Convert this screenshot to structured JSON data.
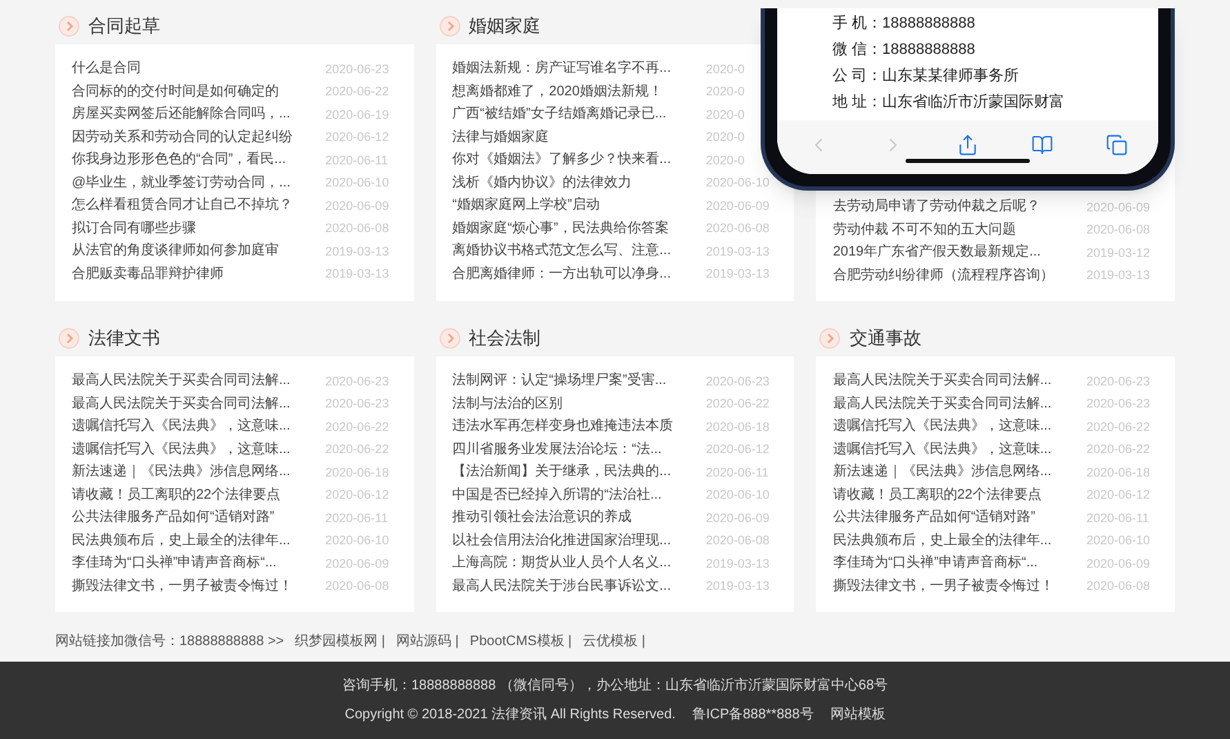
{
  "sections": [
    {
      "title": "合同起草",
      "rows": [
        {
          "title": "什么是合同",
          "date": "2020-06-23"
        },
        {
          "title": "合同标的的交付时间是如何确定的",
          "date": "2020-06-22"
        },
        {
          "title": "房屋买卖网签后还能解除合同吗，...",
          "date": "2020-06-19"
        },
        {
          "title": "因劳动关系和劳动合同的认定起纠纷",
          "date": "2020-06-12"
        },
        {
          "title": "你我身边形形色色的“合同”，看民...",
          "date": "2020-06-11"
        },
        {
          "title": "@毕业生，就业季签订劳动合同，...",
          "date": "2020-06-10"
        },
        {
          "title": "怎么样看租赁合同才让自己不掉坑？",
          "date": "2020-06-09"
        },
        {
          "title": "拟订合同有哪些步骤",
          "date": "2020-06-08"
        },
        {
          "title": "从法官的角度谈律师如何参加庭审",
          "date": "2019-03-13"
        },
        {
          "title": "合肥贩卖毒品罪辩护律师",
          "date": "2019-03-13"
        }
      ]
    },
    {
      "title": "婚姻家庭",
      "rows": [
        {
          "title": "婚姻法新规：房产证写谁名字不再...",
          "date": "2020-0"
        },
        {
          "title": "想离婚都难了，2020婚姻法新规！",
          "date": "2020-0"
        },
        {
          "title": "广西“被结婚”女子结婚离婚记录已...",
          "date": "2020-0"
        },
        {
          "title": "法律与婚姻家庭",
          "date": "2020-0"
        },
        {
          "title": "你对《婚姻法》了解多少？快来看...",
          "date": "2020-0"
        },
        {
          "title": "浅析《婚内协议》的法律效力",
          "date": "2020-06-10"
        },
        {
          "title": "“婚姻家庭网上学校”启动",
          "date": "2020-06-09"
        },
        {
          "title": "婚姻家庭“烦心事”，民法典给你答案",
          "date": "2020-06-08"
        },
        {
          "title": "离婚协议书格式范文怎么写、注意...",
          "date": "2019-03-13"
        },
        {
          "title": "合肥离婚律师：一方出轨可以净身...",
          "date": "2019-03-13"
        }
      ]
    },
    {
      "rows": [
        {
          "title": "去劳动局申请了劳动仲裁之后呢？",
          "date": "2020-06-09"
        },
        {
          "title": "劳动仲裁 不可不知的五大问题",
          "date": "2020-06-08"
        },
        {
          "title": "2019年广东省产假天数最新规定...",
          "date": "2019-03-12"
        },
        {
          "title": "合肥劳动纠纷律师（流程程序咨询）",
          "date": "2019-03-13"
        }
      ]
    },
    {
      "title": "法律文书",
      "rows": [
        {
          "title": "最高人民法院关于买卖合同司法解...",
          "date": "2020-06-23"
        },
        {
          "title": "最高人民法院关于买卖合同司法解...",
          "date": "2020-06-23"
        },
        {
          "title": "遗嘱信托写入《民法典》，这意味...",
          "date": "2020-06-22"
        },
        {
          "title": "遗嘱信托写入《民法典》，这意味...",
          "date": "2020-06-22"
        },
        {
          "title": "新法速递｜《民法典》涉信息网络...",
          "date": "2020-06-18"
        },
        {
          "title": "请收藏！员工离职的22个法律要点",
          "date": "2020-06-12"
        },
        {
          "title": "公共法律服务产品如何“适销对路”",
          "date": "2020-06-11"
        },
        {
          "title": "民法典颁布后，史上最全的法律年...",
          "date": "2020-06-10"
        },
        {
          "title": "李佳琦为“口头禅”申请声音商标“...",
          "date": "2020-06-09"
        },
        {
          "title": "撕毁法律文书，一男子被责令悔过！",
          "date": "2020-06-08"
        }
      ]
    },
    {
      "title": "社会法制",
      "rows": [
        {
          "title": "法制网评：认定“操场埋尸案”受害...",
          "date": "2020-06-23"
        },
        {
          "title": "法制与法治的区别",
          "date": "2020-06-22"
        },
        {
          "title": "违法水军再怎样变身也难掩违法本质",
          "date": "2020-06-18"
        },
        {
          "title": "四川省服务业发展法治论坛：“法...",
          "date": "2020-06-12"
        },
        {
          "title": "【法治新闻】关于继承，民法典的...",
          "date": "2020-06-11"
        },
        {
          "title": "中国是否已经掉入所谓的“法治社...",
          "date": "2020-06-10"
        },
        {
          "title": "推动引领社会法治意识的养成",
          "date": "2020-06-09"
        },
        {
          "title": "以社会信用法治化推进国家治理现...",
          "date": "2020-06-08"
        },
        {
          "title": "上海高院：期货从业人员个人名义...",
          "date": "2019-03-13"
        },
        {
          "title": "最高人民法院关于涉台民事诉讼文...",
          "date": "2019-03-13"
        }
      ]
    },
    {
      "title": "交通事故",
      "rows": [
        {
          "title": "最高人民法院关于买卖合同司法解...",
          "date": "2020-06-23"
        },
        {
          "title": "最高人民法院关于买卖合同司法解...",
          "date": "2020-06-23"
        },
        {
          "title": "遗嘱信托写入《民法典》，这意味...",
          "date": "2020-06-22"
        },
        {
          "title": "遗嘱信托写入《民法典》，这意味...",
          "date": "2020-06-22"
        },
        {
          "title": "新法速递｜《民法典》涉信息网络...",
          "date": "2020-06-18"
        },
        {
          "title": "请收藏！员工离职的22个法律要点",
          "date": "2020-06-12"
        },
        {
          "title": "公共法律服务产品如何“适销对路”",
          "date": "2020-06-11"
        },
        {
          "title": "民法典颁布后，史上最全的法律年...",
          "date": "2020-06-10"
        },
        {
          "title": "李佳琦为“口头禅”申请声音商标“...",
          "date": "2020-06-09"
        },
        {
          "title": "撕毁法律文书，一男子被责令悔过！",
          "date": "2020-06-08"
        }
      ]
    }
  ],
  "phone_overlay": {
    "lines": [
      "手 机：18888888888",
      "微 信：18888888888",
      "公 司：山东某某律师事务所",
      "地 址：山东省临沂市沂蒙国际财富"
    ],
    "toolbar": [
      {
        "kind": "back",
        "disabled": true
      },
      {
        "kind": "forward",
        "disabled": true
      },
      {
        "kind": "share",
        "disabled": false
      },
      {
        "kind": "bookmarks",
        "disabled": false
      },
      {
        "kind": "tabs",
        "disabled": false
      }
    ]
  },
  "links": {
    "label": "网站链接加微信号：18888888888 >>",
    "items": [
      "织梦园模板网 |",
      "网站源码 |",
      "PbootCMS模板 |",
      "云优模板 |"
    ]
  },
  "footer": {
    "contact": "咨询手机：18888888888 （微信同号），办公地址：山东省临沂市沂蒙国际财富中心68号",
    "copyright": "Copyright © 2018-2021 法律资讯 All Rights Reserved.",
    "icp": "鲁ICP备888**888号",
    "site_link": "网站模板"
  }
}
